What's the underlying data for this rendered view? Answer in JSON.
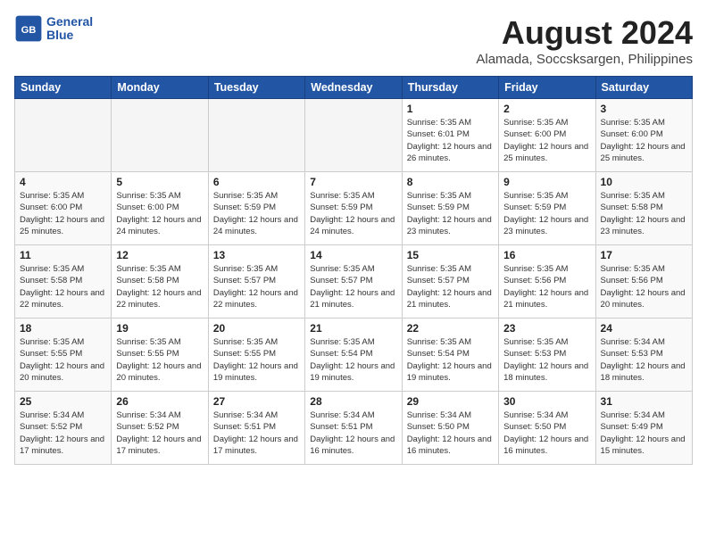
{
  "header": {
    "logo_line1": "General",
    "logo_line2": "Blue",
    "title": "August 2024",
    "subtitle": "Alamada, Soccsksargen, Philippines"
  },
  "days_of_week": [
    "Sunday",
    "Monday",
    "Tuesday",
    "Wednesday",
    "Thursday",
    "Friday",
    "Saturday"
  ],
  "weeks": [
    [
      {
        "day": "",
        "info": ""
      },
      {
        "day": "",
        "info": ""
      },
      {
        "day": "",
        "info": ""
      },
      {
        "day": "",
        "info": ""
      },
      {
        "day": "1",
        "info": "Sunrise: 5:35 AM\nSunset: 6:01 PM\nDaylight: 12 hours\nand 26 minutes."
      },
      {
        "day": "2",
        "info": "Sunrise: 5:35 AM\nSunset: 6:00 PM\nDaylight: 12 hours\nand 25 minutes."
      },
      {
        "day": "3",
        "info": "Sunrise: 5:35 AM\nSunset: 6:00 PM\nDaylight: 12 hours\nand 25 minutes."
      }
    ],
    [
      {
        "day": "4",
        "info": "Sunrise: 5:35 AM\nSunset: 6:00 PM\nDaylight: 12 hours\nand 25 minutes."
      },
      {
        "day": "5",
        "info": "Sunrise: 5:35 AM\nSunset: 6:00 PM\nDaylight: 12 hours\nand 24 minutes."
      },
      {
        "day": "6",
        "info": "Sunrise: 5:35 AM\nSunset: 5:59 PM\nDaylight: 12 hours\nand 24 minutes."
      },
      {
        "day": "7",
        "info": "Sunrise: 5:35 AM\nSunset: 5:59 PM\nDaylight: 12 hours\nand 24 minutes."
      },
      {
        "day": "8",
        "info": "Sunrise: 5:35 AM\nSunset: 5:59 PM\nDaylight: 12 hours\nand 23 minutes."
      },
      {
        "day": "9",
        "info": "Sunrise: 5:35 AM\nSunset: 5:59 PM\nDaylight: 12 hours\nand 23 minutes."
      },
      {
        "day": "10",
        "info": "Sunrise: 5:35 AM\nSunset: 5:58 PM\nDaylight: 12 hours\nand 23 minutes."
      }
    ],
    [
      {
        "day": "11",
        "info": "Sunrise: 5:35 AM\nSunset: 5:58 PM\nDaylight: 12 hours\nand 22 minutes."
      },
      {
        "day": "12",
        "info": "Sunrise: 5:35 AM\nSunset: 5:58 PM\nDaylight: 12 hours\nand 22 minutes."
      },
      {
        "day": "13",
        "info": "Sunrise: 5:35 AM\nSunset: 5:57 PM\nDaylight: 12 hours\nand 22 minutes."
      },
      {
        "day": "14",
        "info": "Sunrise: 5:35 AM\nSunset: 5:57 PM\nDaylight: 12 hours\nand 21 minutes."
      },
      {
        "day": "15",
        "info": "Sunrise: 5:35 AM\nSunset: 5:57 PM\nDaylight: 12 hours\nand 21 minutes."
      },
      {
        "day": "16",
        "info": "Sunrise: 5:35 AM\nSunset: 5:56 PM\nDaylight: 12 hours\nand 21 minutes."
      },
      {
        "day": "17",
        "info": "Sunrise: 5:35 AM\nSunset: 5:56 PM\nDaylight: 12 hours\nand 20 minutes."
      }
    ],
    [
      {
        "day": "18",
        "info": "Sunrise: 5:35 AM\nSunset: 5:55 PM\nDaylight: 12 hours\nand 20 minutes."
      },
      {
        "day": "19",
        "info": "Sunrise: 5:35 AM\nSunset: 5:55 PM\nDaylight: 12 hours\nand 20 minutes."
      },
      {
        "day": "20",
        "info": "Sunrise: 5:35 AM\nSunset: 5:55 PM\nDaylight: 12 hours\nand 19 minutes."
      },
      {
        "day": "21",
        "info": "Sunrise: 5:35 AM\nSunset: 5:54 PM\nDaylight: 12 hours\nand 19 minutes."
      },
      {
        "day": "22",
        "info": "Sunrise: 5:35 AM\nSunset: 5:54 PM\nDaylight: 12 hours\nand 19 minutes."
      },
      {
        "day": "23",
        "info": "Sunrise: 5:35 AM\nSunset: 5:53 PM\nDaylight: 12 hours\nand 18 minutes."
      },
      {
        "day": "24",
        "info": "Sunrise: 5:34 AM\nSunset: 5:53 PM\nDaylight: 12 hours\nand 18 minutes."
      }
    ],
    [
      {
        "day": "25",
        "info": "Sunrise: 5:34 AM\nSunset: 5:52 PM\nDaylight: 12 hours\nand 17 minutes."
      },
      {
        "day": "26",
        "info": "Sunrise: 5:34 AM\nSunset: 5:52 PM\nDaylight: 12 hours\nand 17 minutes."
      },
      {
        "day": "27",
        "info": "Sunrise: 5:34 AM\nSunset: 5:51 PM\nDaylight: 12 hours\nand 17 minutes."
      },
      {
        "day": "28",
        "info": "Sunrise: 5:34 AM\nSunset: 5:51 PM\nDaylight: 12 hours\nand 16 minutes."
      },
      {
        "day": "29",
        "info": "Sunrise: 5:34 AM\nSunset: 5:50 PM\nDaylight: 12 hours\nand 16 minutes."
      },
      {
        "day": "30",
        "info": "Sunrise: 5:34 AM\nSunset: 5:50 PM\nDaylight: 12 hours\nand 16 minutes."
      },
      {
        "day": "31",
        "info": "Sunrise: 5:34 AM\nSunset: 5:49 PM\nDaylight: 12 hours\nand 15 minutes."
      }
    ]
  ]
}
